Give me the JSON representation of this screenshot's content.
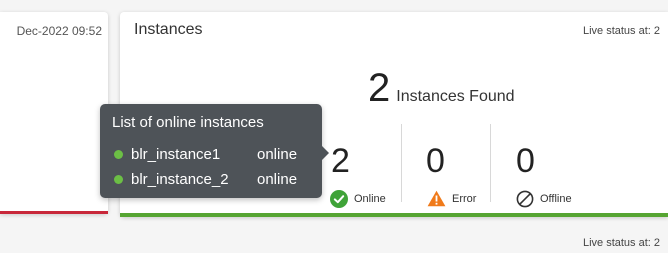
{
  "left_card": {
    "timestamp": "Dec-2022 09:52",
    "accent_color": "#c8283a"
  },
  "instances_card": {
    "title": "Instances",
    "live_status": "Live status at: 2",
    "found_count": "2",
    "found_label": "Instances Found",
    "accent_color": "#56a532",
    "stats": [
      {
        "value": "2",
        "label": "Online",
        "icon": "check-circle-icon",
        "color": "#3fa338"
      },
      {
        "value": "0",
        "label": "Error",
        "icon": "warning-triangle-icon",
        "color": "#f07a1a"
      },
      {
        "value": "0",
        "label": "Offline",
        "icon": "slash-circle-icon",
        "color": "#333333"
      }
    ]
  },
  "tooltip": {
    "title": "List of online instances",
    "items": [
      {
        "name": "blr_instance1",
        "status": "online"
      },
      {
        "name": "blr_instance_2",
        "status": "online"
      }
    ]
  },
  "bottom": {
    "live_status": "Live status at: 2"
  }
}
